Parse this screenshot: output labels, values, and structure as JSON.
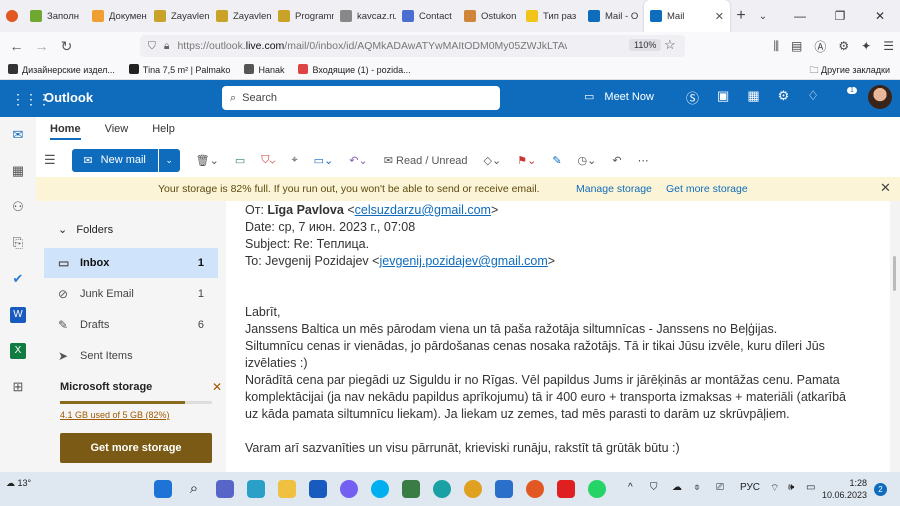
{
  "browser": {
    "tabs": [
      {
        "label": "Заполн",
        "color": "#e25822"
      },
      {
        "label": "Докумен",
        "color": "#6fa831"
      },
      {
        "label": "Zayavlenie",
        "color": "#c9a227"
      },
      {
        "label": "Zayavlenie_",
        "color": "#c9a227"
      },
      {
        "label": "Programma",
        "color": "#c9a227"
      },
      {
        "label": "kavcaz.ru",
        "color": "#888888"
      },
      {
        "label": "Contact",
        "color": "#4a6fd1"
      },
      {
        "label": "Ostukon",
        "color": "#d1853a"
      },
      {
        "label": "Тип раз",
        "color": "#f0c419"
      },
      {
        "label": "Mail - О",
        "color": "#0f6cbd"
      },
      {
        "label": "Mail",
        "color": "#0f6cbd"
      }
    ],
    "url_prefix": "https://outlook.",
    "url_domain": "live.com",
    "url_rest": "/mail/0/inbox/id/AQMkADAwATYwMAItODM0My05ZWJkLTAwAi0wM",
    "zoom": "110%",
    "bookmarks": [
      "Дизайнерские издел...",
      "Tina 7,5 m² | Palmako",
      "Hanak",
      "Входящие (1) - pozida..."
    ],
    "other_bookmarks": "Другие закладки"
  },
  "outlook": {
    "brand": "Outlook",
    "search_placeholder": "Search",
    "meet_now": "Meet Now",
    "notif_count": "1"
  },
  "ribbon": {
    "tabs": [
      "Home",
      "View",
      "Help"
    ],
    "new_mail": "New mail",
    "read_unread": "Read / Unread"
  },
  "banner": {
    "text": "Your storage is 82% full. If you run out, you won't be able to send or receive email.",
    "manage": "Manage storage",
    "get_more": "Get more storage"
  },
  "folders": {
    "header": "Folders",
    "items": [
      {
        "label": "Inbox",
        "count": "1"
      },
      {
        "label": "Junk Email",
        "count": "1"
      },
      {
        "label": "Drafts",
        "count": "6"
      },
      {
        "label": "Sent Items",
        "count": ""
      }
    ],
    "storage_title": "Microsoft storage",
    "storage_used": "4.1 GB used of 5 GB (82%)",
    "storage_fraction": 0.82,
    "get_storage_button": "Get more storage"
  },
  "message": {
    "from_label": "От:",
    "from_name": "Līga Pavlova",
    "from_email": "celsuzdarzu@gmail.com",
    "date_line": "Date: ср, 7 июн. 2023 г., 07:08",
    "subject_line": "Subject: Re: Теплица.",
    "to_label": "To: Jevgenij Pozidajev",
    "to_email": "jevgenij.pozidajev@gmail.com",
    "body": [
      "Labrīt,",
      "Janssens Baltica un mēs pārodam viena un tā paša ražotāja siltumnīcas - Janssens no Beļģijas.",
      "Siltumnīcu cenas ir vienādas, jo pārdošanas cenas nosaka ražotājs. Tā ir tikai Jūsu izvēle, kuru dīleri Jūs",
      "izvēlaties :)",
      "Norādītā cena par piegādi uz Siguldu ir no Rīgas. Vēl papildus Jums ir jārēķinās ar montāžas cenu. Pamata",
      "komplektācijai (ja nav nekādu papildus aprīkojumu) tā ir 400 euro + transporta izmaksas + materiāli (atkarībā",
      "uz kāda pamata siltumnīcu liekam). Ja liekam uz zemes, tad mēs parasti to darām uz skrūvpāļiem.",
      "Varam arī sazvanīties un visu pārrunāt, krieviski runāju, rakstīt tā grūtāk būtu :)"
    ]
  },
  "taskbar": {
    "temperature": "13°",
    "lang": "РУС",
    "time": "1:28",
    "date": "10.06.2023",
    "notifications": "2"
  }
}
